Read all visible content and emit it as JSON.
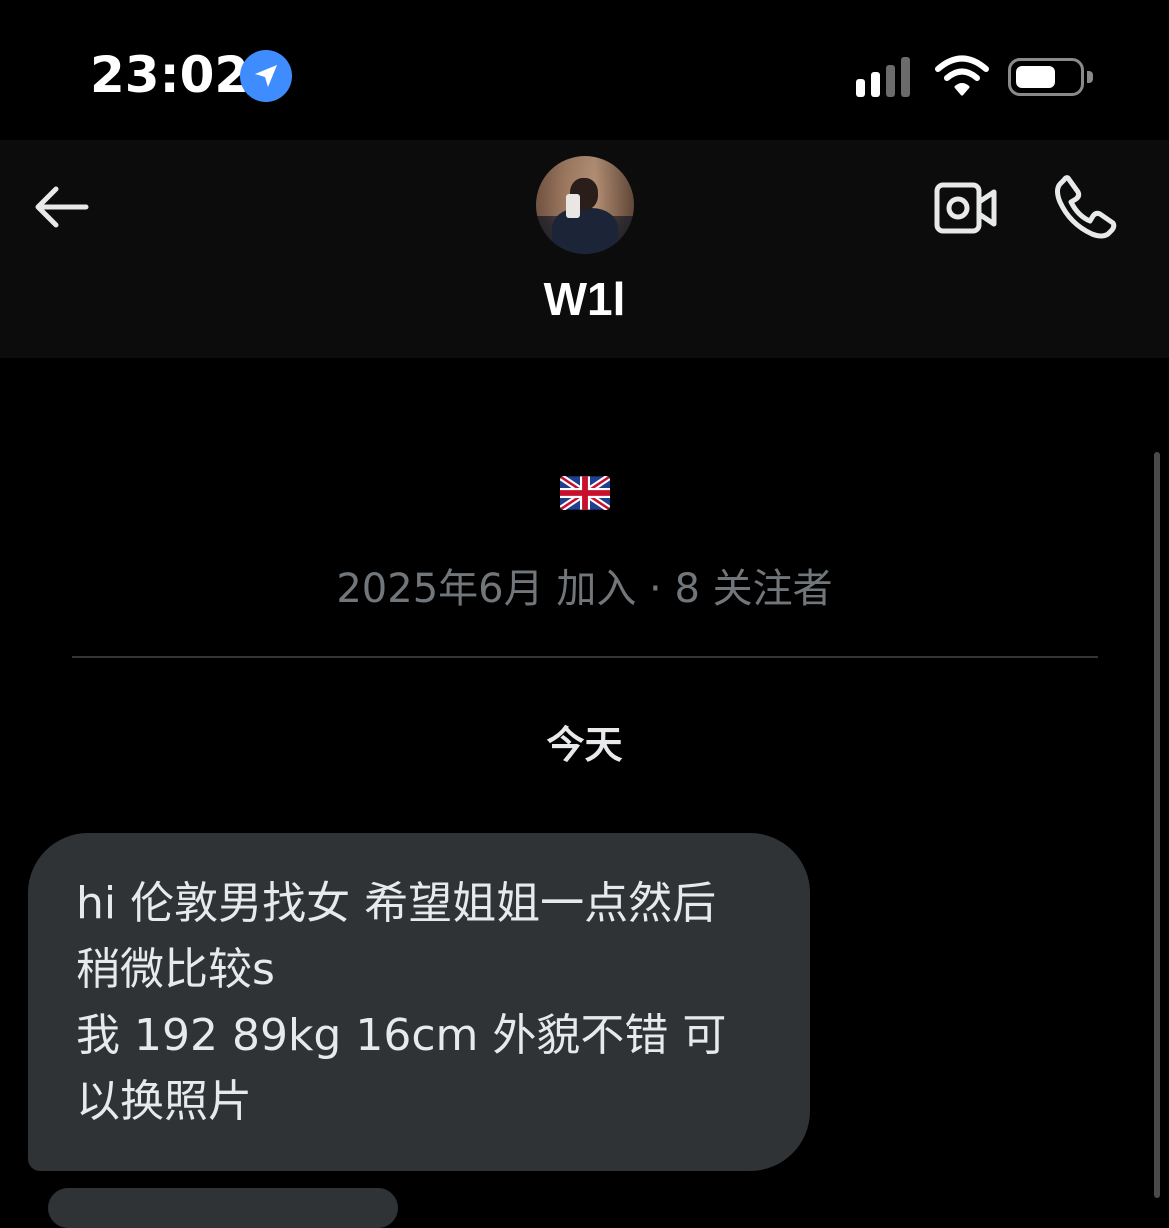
{
  "status_bar": {
    "time": "23:02",
    "icons": [
      "location-arrow-icon",
      "cellular-signal-icon",
      "wifi-icon",
      "battery-icon"
    ],
    "battery_level": 0.65
  },
  "header": {
    "back_icon": "arrow-left-icon",
    "username": "W1l",
    "video_icon": "video-camera-icon",
    "call_icon": "phone-icon"
  },
  "profile": {
    "flag_emoji": "🇬🇧",
    "meta": "2025年6月 加入 · 8 关注者"
  },
  "conversation": {
    "day_label": "今天",
    "messages": [
      {
        "text": "hi 伦敦男找女 希望姐姐一点然后\n稍微比较s\n我 192 89kg 16cm 外貌不错 可\n以换照片"
      }
    ]
  },
  "colors": {
    "background": "#000000",
    "header_bg": "#0c0c0c",
    "bubble": "#2f3336",
    "muted_text": "#71767b",
    "location_blue": "#3f8cff"
  }
}
